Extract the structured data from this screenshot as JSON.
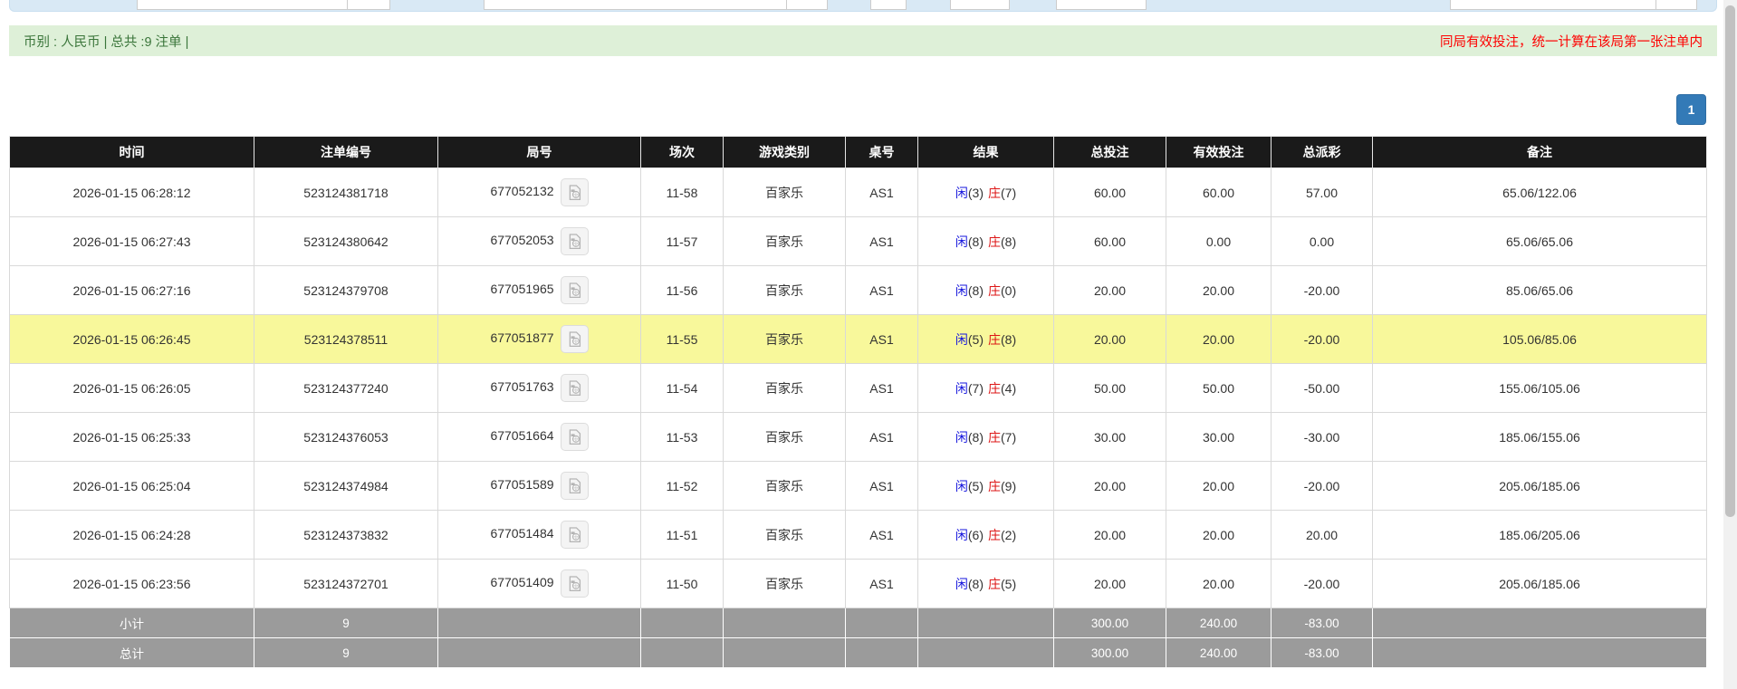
{
  "summary_bar": {
    "left": "币别 : 人民币 | 总共 :9 注单 |",
    "right": "同局有效投注，统一计算在该局第一张注单内"
  },
  "pagination": {
    "page": "1"
  },
  "colors": {
    "header_bg": "#1a1a1a",
    "highlight_row": "#f8f89b",
    "link_blue": "#2a6cd9",
    "negative_red": "#e60000",
    "player_blue": "#1616dd",
    "banker_red": "#dd1616",
    "pagination_blue": "#337ab7",
    "summary_green_bg": "#def0d8",
    "footer_gray": "#9b9b9b"
  },
  "table": {
    "columns": [
      "时间",
      "注单编号",
      "局号",
      "场次",
      "游戏类别",
      "桌号",
      "结果",
      "总投注",
      "有效投注",
      "总派彩",
      "备注"
    ],
    "result_labels": {
      "player": "闲",
      "banker": "庄"
    },
    "rows": [
      {
        "time": "2026-01-15 06:28:12",
        "bet_no": "523124381718",
        "round_no": "677052132",
        "session": "11-58",
        "game_type": "百家乐",
        "table_no": "AS1",
        "player_score": "(3)",
        "banker_score": "(7)",
        "total_bet": "60.00",
        "valid_bet": "60.00",
        "payout": "57.00",
        "remark": "65.06/122.06"
      },
      {
        "time": "2026-01-15 06:27:43",
        "bet_no": "523124380642",
        "round_no": "677052053",
        "session": "11-57",
        "game_type": "百家乐",
        "table_no": "AS1",
        "player_score": "(8)",
        "banker_score": "(8)",
        "total_bet": "60.00",
        "valid_bet": "0.00",
        "payout": "0.00",
        "remark": "65.06/65.06"
      },
      {
        "time": "2026-01-15 06:27:16",
        "bet_no": "523124379708",
        "round_no": "677051965",
        "session": "11-56",
        "game_type": "百家乐",
        "table_no": "AS1",
        "player_score": "(8)",
        "banker_score": "(0)",
        "total_bet": "20.00",
        "valid_bet": "20.00",
        "payout": "-20.00",
        "remark": "85.06/65.06"
      },
      {
        "time": "2026-01-15 06:26:45",
        "bet_no": "523124378511",
        "round_no": "677051877",
        "session": "11-55",
        "game_type": "百家乐",
        "table_no": "AS1",
        "player_score": "(5)",
        "banker_score": "(8)",
        "total_bet": "20.00",
        "valid_bet": "20.00",
        "payout": "-20.00",
        "remark": "105.06/85.06"
      },
      {
        "time": "2026-01-15 06:26:05",
        "bet_no": "523124377240",
        "round_no": "677051763",
        "session": "11-54",
        "game_type": "百家乐",
        "table_no": "AS1",
        "player_score": "(7)",
        "banker_score": "(4)",
        "total_bet": "50.00",
        "valid_bet": "50.00",
        "payout": "-50.00",
        "remark": "155.06/105.06"
      },
      {
        "time": "2026-01-15 06:25:33",
        "bet_no": "523124376053",
        "round_no": "677051664",
        "session": "11-53",
        "game_type": "百家乐",
        "table_no": "AS1",
        "player_score": "(8)",
        "banker_score": "(7)",
        "total_bet": "30.00",
        "valid_bet": "30.00",
        "payout": "-30.00",
        "remark": "185.06/155.06"
      },
      {
        "time": "2026-01-15 06:25:04",
        "bet_no": "523124374984",
        "round_no": "677051589",
        "session": "11-52",
        "game_type": "百家乐",
        "table_no": "AS1",
        "player_score": "(5)",
        "banker_score": "(9)",
        "total_bet": "20.00",
        "valid_bet": "20.00",
        "payout": "-20.00",
        "remark": "205.06/185.06"
      },
      {
        "time": "2026-01-15 06:24:28",
        "bet_no": "523124373832",
        "round_no": "677051484",
        "session": "11-51",
        "game_type": "百家乐",
        "table_no": "AS1",
        "player_score": "(6)",
        "banker_score": "(2)",
        "total_bet": "20.00",
        "valid_bet": "20.00",
        "payout": "20.00",
        "remark": "185.06/205.06"
      },
      {
        "time": "2026-01-15 06:23:56",
        "bet_no": "523124372701",
        "round_no": "677051409",
        "session": "11-50",
        "game_type": "百家乐",
        "table_no": "AS1",
        "player_score": "(8)",
        "banker_score": "(5)",
        "total_bet": "20.00",
        "valid_bet": "20.00",
        "payout": "-20.00",
        "remark": "205.06/185.06"
      }
    ],
    "subtotal": {
      "label": "小计",
      "count": "9",
      "total_bet": "300.00",
      "valid_bet": "240.00",
      "payout": "-83.00"
    },
    "total": {
      "label": "总计",
      "count": "9",
      "total_bet": "300.00",
      "valid_bet": "240.00",
      "payout": "-83.00"
    }
  }
}
